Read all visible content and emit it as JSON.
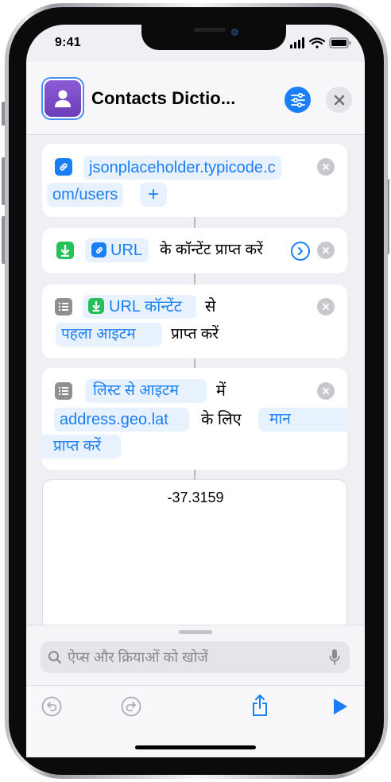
{
  "status_bar": {
    "time": "9:41"
  },
  "header": {
    "title": "Contacts Dictio...",
    "app_icon": "person-icon",
    "settings_icon": "sliders-icon",
    "close_icon": "close-icon"
  },
  "actions": [
    {
      "name": "url-action",
      "icon": "link-icon",
      "url_line1": "jsonplaceholder.typicode.c",
      "url_line2": "om/users",
      "add_label": "+"
    },
    {
      "name": "get-contents-action",
      "icon": "download-icon",
      "param": "URL",
      "text": "के कॉन्टेंट प्राप्त करें"
    },
    {
      "name": "get-item-action",
      "icon": "list-icon",
      "param": "URL कॉन्टेंट",
      "text1": "से",
      "param2": "पहला आइटम",
      "text2": "प्राप्त करें"
    },
    {
      "name": "get-dict-value-action",
      "icon": "list-icon",
      "param": "लिस्ट से आइटम",
      "text1": "में",
      "key": "address.geo.lat",
      "text2": "के लिए",
      "param2_line1": "मान",
      "param2_line2": "प्राप्त करें"
    }
  ],
  "result": {
    "value": "-37.3159"
  },
  "search": {
    "placeholder": "ऐप्स और क्रियाओं को खोजें"
  },
  "colors": {
    "accent": "#1a7ef5",
    "pill_bg": "#e8f2fe",
    "green": "#24c15a",
    "purple": "#7a4cc8"
  }
}
